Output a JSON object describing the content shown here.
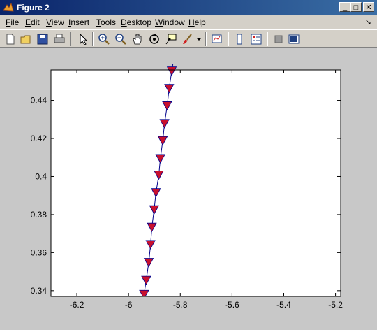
{
  "window": {
    "title": "Figure 2",
    "buttons": {
      "minimize": "_",
      "maximize": "□",
      "close": "✕"
    }
  },
  "menubar": {
    "items": [
      {
        "label": "File",
        "mnemonic": "F",
        "rest": "ile"
      },
      {
        "label": "Edit",
        "mnemonic": "E",
        "rest": "dit"
      },
      {
        "label": "View",
        "mnemonic": "V",
        "rest": "iew"
      },
      {
        "label": "Insert",
        "mnemonic": "I",
        "rest": "nsert"
      },
      {
        "label": "Tools",
        "mnemonic": "T",
        "rest": "ools"
      },
      {
        "label": "Desktop",
        "mnemonic": "D",
        "rest": "esktop"
      },
      {
        "label": "Window",
        "mnemonic": "W",
        "rest": "indow"
      },
      {
        "label": "Help",
        "mnemonic": "H",
        "rest": "elp"
      }
    ],
    "dock_arrow": "↘"
  },
  "toolbar": {
    "icons": [
      "new-figure-icon",
      "open-file-icon",
      "save-icon",
      "print-icon",
      "pointer-icon",
      "zoom-in-icon",
      "zoom-out-icon",
      "pan-hand-icon",
      "rotate-3d-icon",
      "data-cursor-icon",
      "brush-icon",
      "dropdown-arrow-icon",
      "link-plot-icon",
      "colorbar-icon",
      "legend-icon",
      "hide-plot-tools-icon",
      "show-plot-tools-icon"
    ]
  },
  "chart_data": {
    "type": "line",
    "xlim": [
      -6.3,
      -5.18
    ],
    "ylim": [
      0.337,
      0.456
    ],
    "xticks": [
      -6.2,
      -6,
      -5.8,
      -5.6,
      -5.4,
      -5.2
    ],
    "xtick_labels": [
      "-6.2",
      "-6",
      "-5.8",
      "-5.6",
      "-5.4",
      "-5.2"
    ],
    "yticks": [
      0.34,
      0.36,
      0.38,
      0.4,
      0.42,
      0.44
    ],
    "ytick_labels": [
      "0.34",
      "0.36",
      "0.38",
      "0.4",
      "0.42",
      "0.44"
    ],
    "grid": false,
    "line_color": "#00008b",
    "marker": "triangle-down",
    "marker_color": "#c8102e",
    "series": [
      {
        "x": [
          -5.94,
          -5.932,
          -5.922,
          -5.915,
          -5.91,
          -5.901,
          -5.894,
          -5.883,
          -5.877,
          -5.868,
          -5.861,
          -5.851,
          -5.843,
          -5.833,
          -5.822
        ],
        "y": [
          0.338,
          0.3454,
          0.3548,
          0.3642,
          0.3733,
          0.3825,
          0.3915,
          0.4007,
          0.4094,
          0.4188,
          0.4278,
          0.4371,
          0.4462,
          0.4554,
          0.4642
        ]
      }
    ]
  }
}
